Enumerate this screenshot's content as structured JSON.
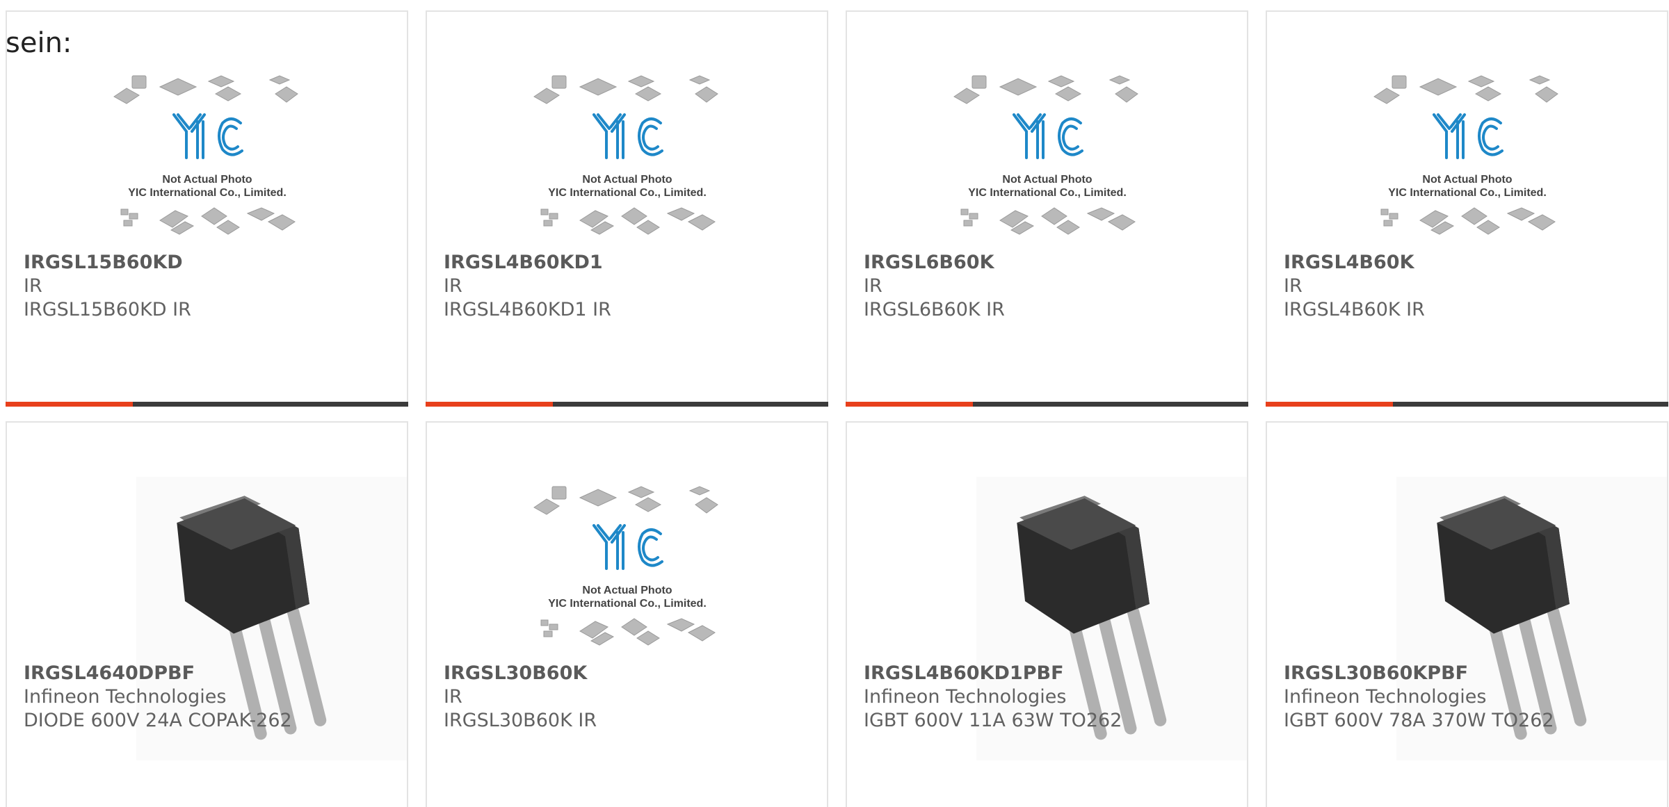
{
  "intro_text": "sein:",
  "placeholder": {
    "line1": "Not Actual Photo",
    "line2": "YIC International Co., Limited.",
    "logo": "YIC"
  },
  "colors": {
    "accent": "#e8401c",
    "bar": "#3b3b3b",
    "text": "#616161",
    "logo": "#1e88c8"
  },
  "cards": [
    {
      "part": "IRGSL15B60KD",
      "maker": "IR",
      "desc": "IRGSL15B60KD IR",
      "image": "not-actual-photo"
    },
    {
      "part": "IRGSL4B60KD1",
      "maker": "IR",
      "desc": "IRGSL4B60KD1 IR",
      "image": "not-actual-photo"
    },
    {
      "part": "IRGSL6B60K",
      "maker": "IR",
      "desc": "IRGSL6B60K IR",
      "image": "not-actual-photo"
    },
    {
      "part": "IRGSL4B60K",
      "maker": "IR",
      "desc": "IRGSL4B60K IR",
      "image": "not-actual-photo"
    },
    {
      "part": "IRGSL4640DPBF",
      "maker": "Infineon Technologies",
      "desc": "DIODE 600V 24A COPAK-262",
      "image": "to262-package"
    },
    {
      "part": "IRGSL30B60K",
      "maker": "IR",
      "desc": "IRGSL30B60K IR",
      "image": "not-actual-photo"
    },
    {
      "part": "IRGSL4B60KD1PBF",
      "maker": "Infineon Technologies",
      "desc": "IGBT 600V 11A 63W TO262",
      "image": "to262-package"
    },
    {
      "part": "IRGSL30B60KPBF",
      "maker": "Infineon Technologies",
      "desc": "IGBT 600V 78A 370W TO262",
      "image": "to262-package"
    }
  ]
}
